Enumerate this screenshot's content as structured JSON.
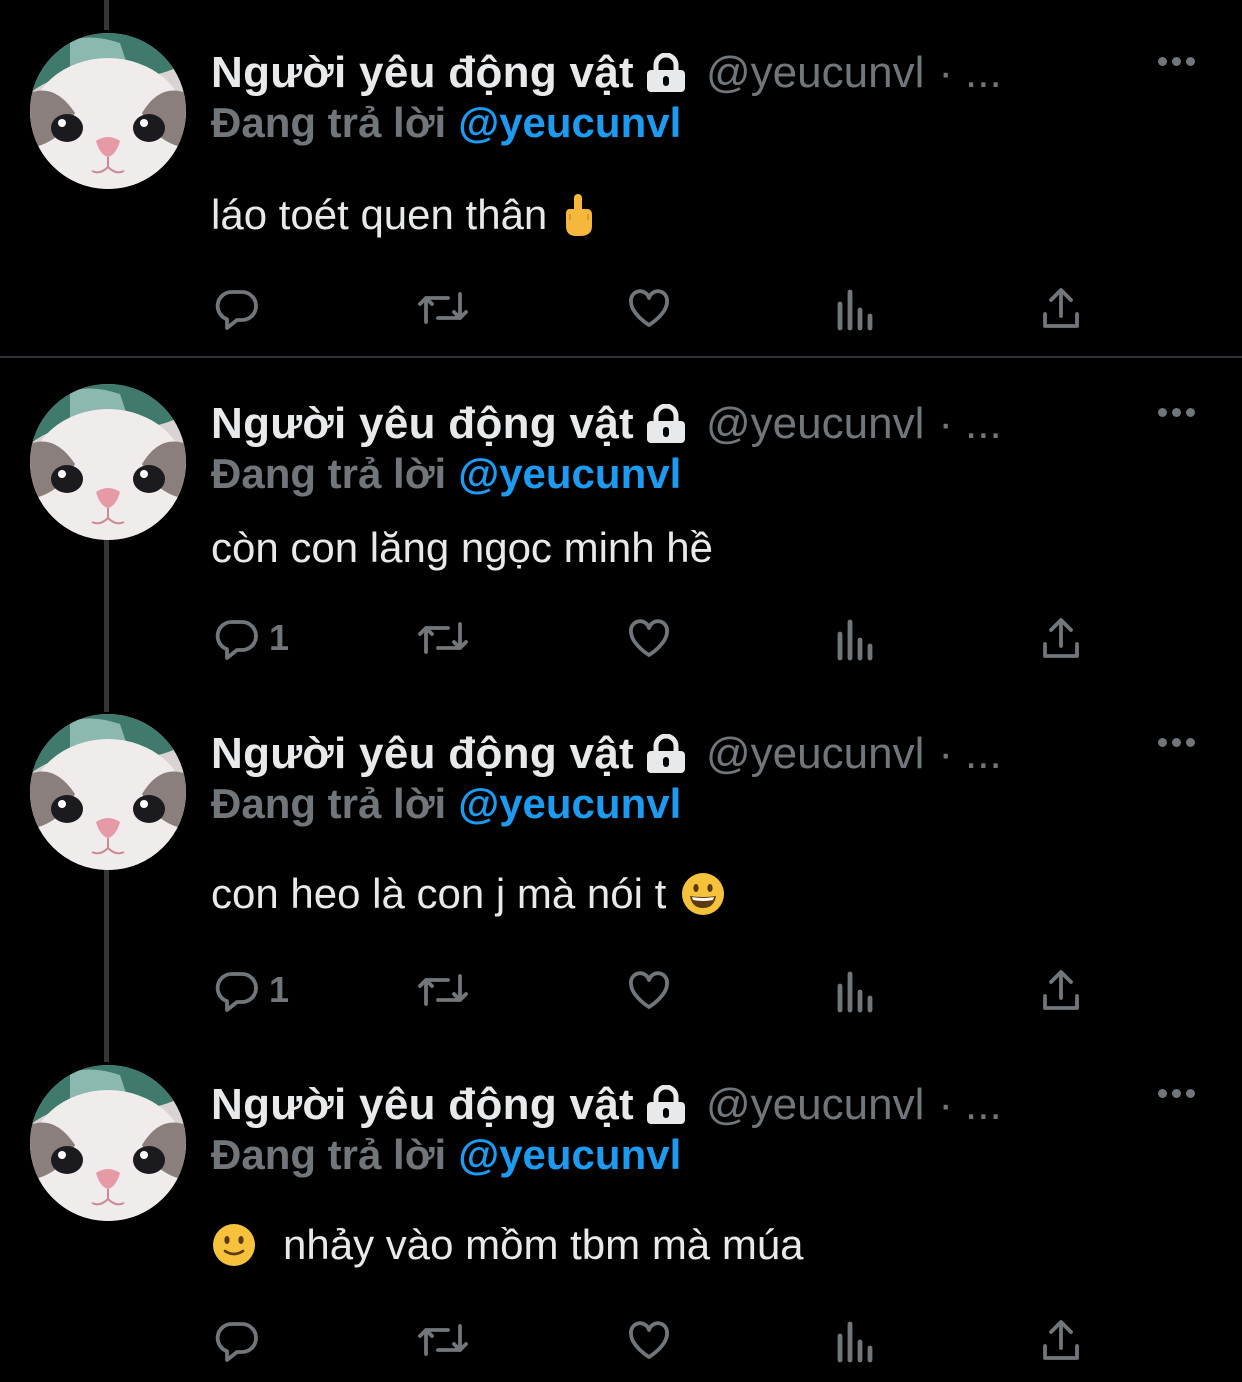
{
  "tweets": [
    {
      "display_name": "Người yêu động vật",
      "handle": "@yeucunvl",
      "dot": "·",
      "ellipsis": "...",
      "reply_prefix": "Đang trả lời",
      "reply_handle": "@yeucunvl",
      "text": "láo toét quen thân",
      "emoji": "middle-finger-icon",
      "reply_count": ""
    },
    {
      "display_name": "Người yêu động vật",
      "handle": "@yeucunvl",
      "dot": "·",
      "ellipsis": "...",
      "reply_prefix": "Đang trả lời",
      "reply_handle": "@yeucunvl",
      "text": "còn con lăng ngọc minh hề",
      "emoji": "",
      "reply_count": "1"
    },
    {
      "display_name": "Người yêu động vật",
      "handle": "@yeucunvl",
      "dot": "·",
      "ellipsis": "...",
      "reply_prefix": "Đang trả lời",
      "reply_handle": "@yeucunvl",
      "text": "con heo là con j mà nói t",
      "emoji": "grinning-face-icon",
      "reply_count": "1"
    },
    {
      "display_name": "Người yêu động vật",
      "handle": "@yeucunvl",
      "dot": "·",
      "ellipsis": "...",
      "reply_prefix": "Đang trả lời",
      "reply_handle": "@yeucunvl",
      "text": "nhảy vào mồm tbm mà múa",
      "emoji": "slightly-smiling-face-icon",
      "reply_count": ""
    }
  ],
  "colors": {
    "background": "#000000",
    "primary_text": "#e7e9ea",
    "secondary_text": "#71767b",
    "accent": "#1d9bf0",
    "thread_line": "#333639",
    "divider": "#2f3336"
  }
}
